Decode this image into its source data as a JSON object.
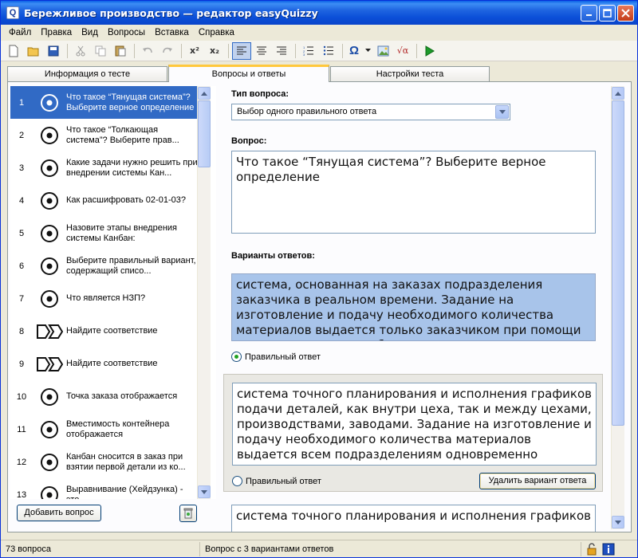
{
  "window": {
    "title": "Бережливое производство — редактор easyQuizzy",
    "app_icon": "Q"
  },
  "menu": [
    "Файл",
    "Правка",
    "Вид",
    "Вопросы",
    "Вставка",
    "Справка"
  ],
  "toolbar": {
    "superscript_label": "x²",
    "subscript_label": "x₂",
    "omega_label": "Ω",
    "formula_label": "√α"
  },
  "tabs": [
    {
      "label": "Информация о тесте",
      "active": false
    },
    {
      "label": "Вопросы и ответы",
      "active": true
    },
    {
      "label": "Настройки теста",
      "active": false
    }
  ],
  "questions": [
    {
      "num": "1",
      "icon": "single-choice-icon",
      "text": "Что такое “Тянущая система”? Выберите верное определение",
      "selected": true
    },
    {
      "num": "2",
      "icon": "single-choice-icon",
      "text": "Что такое “Толкающая система”?      Выберите прав..."
    },
    {
      "num": "3",
      "icon": "single-choice-icon",
      "text": "Какие задачи нужно решить при внедрении системы Кан..."
    },
    {
      "num": "4",
      "icon": "single-choice-icon",
      "text": "Как расшифровать 02-01-03?"
    },
    {
      "num": "5",
      "icon": "single-choice-icon",
      "text": "Назовите этапы внедрения системы Канбан:"
    },
    {
      "num": "6",
      "icon": "single-choice-icon",
      "text": "Выберите правильный вариант, содержащий списо..."
    },
    {
      "num": "7",
      "icon": "single-choice-icon",
      "text": "Что  является  НЗП?"
    },
    {
      "num": "8",
      "icon": "matching-icon",
      "text": "Найдите соответствие"
    },
    {
      "num": "9",
      "icon": "matching-icon",
      "text": "Найдите соответствие"
    },
    {
      "num": "10",
      "icon": "single-choice-icon",
      "text": "Точка заказа отображается"
    },
    {
      "num": "11",
      "icon": "single-choice-icon",
      "text": "Вместимость контейнера отображается"
    },
    {
      "num": "12",
      "icon": "single-choice-icon",
      "text": "Канбан сносится в заказ при взятии первой детали из ко..."
    },
    {
      "num": "13",
      "icon": "single-choice-icon",
      "text": "Выравнивание (Хейдзунка)  - это"
    }
  ],
  "buttons": {
    "add_question": "Добавить вопрос",
    "delete_answer": "Удалить вариант ответа"
  },
  "editor": {
    "question_type_label": "Тип вопроса:",
    "question_type_value": "Выбор одного правильного ответа",
    "question_label": "Вопрос:",
    "question_text": "Что такое “Тянущая система”? Выберите верное определение",
    "answers_label": "Варианты ответов:",
    "answers": [
      {
        "text": "система, основанная на  заказах подразделения заказчика в реальном времени. Задание на изготовление и подачу необходимого количества материалов выдается только заказчиком при помощи сигнала-карточки Канбан",
        "correct_label": "Правильный ответ",
        "correct": true
      },
      {
        "text": "система точного планирования и исполнения графиков подачи деталей, как внутри цеха, так и между цехами, производствами, заводами. Задание на изготовление и подачу необходимого количества материалов выдается всем подразделениям одновременно",
        "correct_label": "Правильный ответ",
        "correct": false
      },
      {
        "text": "система точного планирования и исполнения графиков",
        "correct": false
      }
    ]
  },
  "status": {
    "count": "73 вопроса",
    "info": "Вопрос с 3 вариантами ответов"
  },
  "colors": {
    "selection": "#316ac5",
    "highlight": "#a8c4ea",
    "titlebar": "#0a44c9"
  }
}
